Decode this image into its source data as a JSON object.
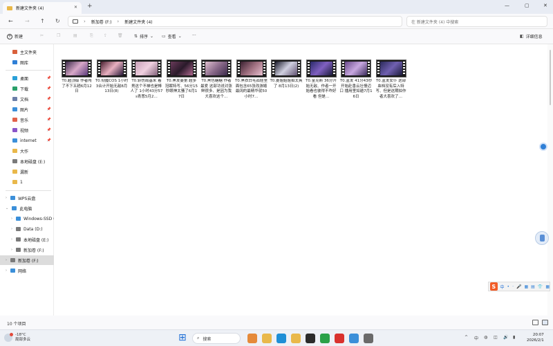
{
  "window": {
    "tab_title": "新建文件夹 (4)",
    "tab_close": "✕",
    "new_tab": "+",
    "controls": [
      "—",
      "▢",
      "✕"
    ]
  },
  "nav": {
    "back": "←",
    "forward": "→",
    "up": "↑",
    "refresh": "↻",
    "breadcrumb": [
      "新加卷 (F:)",
      "新建文件夹 (4)"
    ],
    "breadcrumb_sep": "›",
    "search_placeholder": "在 新建文件夹 (4) 中搜索"
  },
  "toolbar": {
    "new_label": "新建",
    "sort_label": "排序",
    "view_label": "查看",
    "more": "···",
    "details_label": "详细信息"
  },
  "sidebar": {
    "top": [
      {
        "label": "主文件夹",
        "icon": "home-icon",
        "color": "#d9603b"
      },
      {
        "label": "图库",
        "icon": "gallery-icon",
        "color": "#2f7fd6"
      }
    ],
    "quick": [
      {
        "label": "桌面",
        "icon": "desktop-icon",
        "color": "#2aa0d8",
        "pinned": true
      },
      {
        "label": "下载",
        "icon": "download-icon",
        "color": "#2aa06a",
        "pinned": true
      },
      {
        "label": "文档",
        "icon": "documents-icon",
        "color": "#6b7fa8",
        "pinned": true
      },
      {
        "label": "图片",
        "icon": "pictures-icon",
        "color": "#3b8fd9",
        "pinned": true
      },
      {
        "label": "音乐",
        "icon": "music-icon",
        "color": "#e2624a",
        "pinned": true
      },
      {
        "label": "视频",
        "icon": "videos-icon",
        "color": "#8a55c9",
        "pinned": true
      },
      {
        "label": "internet",
        "icon": "internet-folder-icon",
        "color": "#3b8fd9",
        "pinned": true
      },
      {
        "label": "大作",
        "icon": "folder-icon",
        "color": "#e9b84a",
        "pinned": false
      },
      {
        "label": "本地磁盘 (E:)",
        "icon": "drive-icon",
        "color": "#7a7a7a",
        "pinned": false
      },
      {
        "label": "漏新",
        "icon": "folder-icon",
        "color": "#e9b84a",
        "pinned": false
      },
      {
        "label": "1",
        "icon": "folder-icon",
        "color": "#e9b84a",
        "pinned": false
      }
    ],
    "pin_glyph": "📌",
    "tree": [
      {
        "label": "WPS云盘",
        "icon": "cloud-icon",
        "color": "#3b8fd9",
        "indent": 0
      },
      {
        "label": "此电脑",
        "icon": "pc-icon",
        "color": "#3b8fd9",
        "indent": 0,
        "expanded": true
      },
      {
        "label": "Windows-SSD (C:)",
        "icon": "windows-drive-icon",
        "color": "#3b8fd9",
        "indent": 1
      },
      {
        "label": "Data (D:)",
        "icon": "drive-icon",
        "color": "#7a7a7a",
        "indent": 1
      },
      {
        "label": "本地磁盘 (E:)",
        "icon": "drive-icon",
        "color": "#7a7a7a",
        "indent": 1
      },
      {
        "label": "新加卷 (F:)",
        "icon": "drive-icon",
        "color": "#7a7a7a",
        "indent": 1
      },
      {
        "label": "新加卷 (F:)",
        "icon": "drive-icon",
        "color": "#7a7a7a",
        "indent": 0,
        "selected": true
      },
      {
        "label": "网络",
        "icon": "network-icon",
        "color": "#3b8fd9",
        "indent": 0
      }
    ],
    "chev_collapsed": "›",
    "chev_expanded": "⌄"
  },
  "files": [
    {
      "name": "T0.超顶级 作者闯了不下五趟6月12日",
      "colors": [
        "#3d2a4a",
        "#d8a8c8",
        "#5a3a7a"
      ]
    },
    {
      "name": "T0.彻魔COS 1小时3合计开始无敌8月13日(8)",
      "colors": [
        "#4a2030",
        "#e8b0c0",
        "#2a1a3a"
      ]
    },
    {
      "name": "T0.斩伤局基米 着男这个不禅也是棒人了 1小时43分57s青葱5月2…",
      "colors": [
        "#c8a0b8",
        "#f0d0e0",
        "#806078"
      ]
    },
    {
      "name": "T0.黑发姜第 超多冠眠特写、56分15秒眼神太骚了6月17日",
      "colors": [
        "#6a3a5a",
        "#2a1a2a",
        "#b06890"
      ]
    },
    {
      "name": "T0.黑色糖糖 作者最爱 这部功说对涨鲜很多、是因为我大喜欢这个…",
      "colors": [
        "#e0c0d0",
        "#8a6a8a",
        "#3a2a4a"
      ]
    },
    {
      "name": "T0.黑衣白毛孤娃里面包含65张改游嬉最阔的最精华就50小时7…",
      "colors": [
        "#3a2030",
        "#a07080",
        "#e8c0d0"
      ]
    },
    {
      "name": "T0.菱姐姐姐拍太爽了 8月13日(2)",
      "colors": [
        "#1a1a2a",
        "#d0d0e0",
        "#605070"
      ]
    },
    {
      "name": "T0.金克斯 36分开始无敌、作者一开始看也彼得不咋好看 但是…",
      "colors": [
        "#2a2a6a",
        "#8060c0",
        "#1a1a3a"
      ]
    },
    {
      "name": "T0.蓝发 41分43秒开始赴香云壮慢迈口 播用里如遁7月16日",
      "colors": [
        "#6a4a8a",
        "#c8a8e0",
        "#3a2a5a"
      ]
    },
    {
      "name": "T0.蓝发女仆 这部血档没有后入特写、但是这期拍作者大喜欢了…",
      "colors": [
        "#2a2a5a",
        "#7060b0",
        "#1a1a3a"
      ]
    }
  ],
  "status": {
    "item_count": "10 个项目"
  },
  "ime": {
    "logo": "S",
    "items": [
      "中",
      "•",
      "·",
      "🎤",
      "▦",
      "▤",
      "👕",
      "▦"
    ]
  },
  "taskbar": {
    "weather_temp": "-18°C",
    "weather_desc": "局部多云",
    "search_label": "搜索",
    "search_glyph": "⌕",
    "start_glyph": "⊞",
    "tray": [
      "^",
      "中",
      "◍",
      "◫",
      "🔊",
      "▮"
    ],
    "time": "20:07",
    "date": "2026/2/1",
    "apps": [
      {
        "name": "mountain-app-icon",
        "color": "#e58a3a"
      },
      {
        "name": "file-explorer-icon",
        "color": "#e9b84a"
      },
      {
        "name": "edge-icon",
        "color": "#1f8fd6"
      },
      {
        "name": "folder-app-icon",
        "color": "#e9b84a"
      },
      {
        "name": "terminal-icon",
        "color": "#2b2b2b"
      },
      {
        "name": "wechat-icon",
        "color": "#2aa148"
      },
      {
        "name": "wps-icon",
        "color": "#d9322e"
      },
      {
        "name": "cloud-app-icon",
        "color": "#3b8fd9"
      },
      {
        "name": "settings-app-icon",
        "color": "#6a6a6a"
      }
    ]
  },
  "accent": "#3b8fd9"
}
